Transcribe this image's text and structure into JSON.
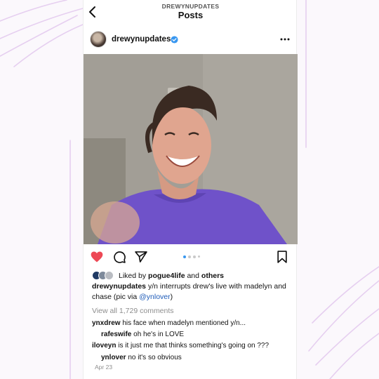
{
  "header": {
    "account_caps": "DREWYNUPDATES",
    "title": "Posts"
  },
  "post": {
    "username": "drewynupdates",
    "verified": true,
    "image_description_icon": "photo",
    "carousel": {
      "count": 4,
      "active_index": 0
    },
    "liked": true,
    "likes": {
      "prefix": "Liked by",
      "user": "pogue4life",
      "joiner": "and",
      "others": "others"
    },
    "caption": {
      "username": "drewynupdates",
      "text": "y/n interrupts drew's live with madelyn and chase (pic via ",
      "mention": "@ynlover",
      "suffix": ")"
    },
    "view_all_comments": "View all 1,729 comments",
    "comments": [
      {
        "user": "ynxdrew",
        "text": "his face when madelyn mentioned y/n...",
        "reply": false
      },
      {
        "user": "rafeswife",
        "text": "oh he's in LOVE",
        "reply": true
      },
      {
        "user": "iloveyn",
        "text": "is it just me that thinks something's going on ???",
        "reply": false
      },
      {
        "user": "ynlover",
        "text": "no it's so obvious",
        "reply": true
      }
    ],
    "date": "Apr 23"
  },
  "colors": {
    "heart": "#ed4956",
    "verified": "#3897f0",
    "decor": "#e3c8ee",
    "mention": "#1e5bb8"
  }
}
